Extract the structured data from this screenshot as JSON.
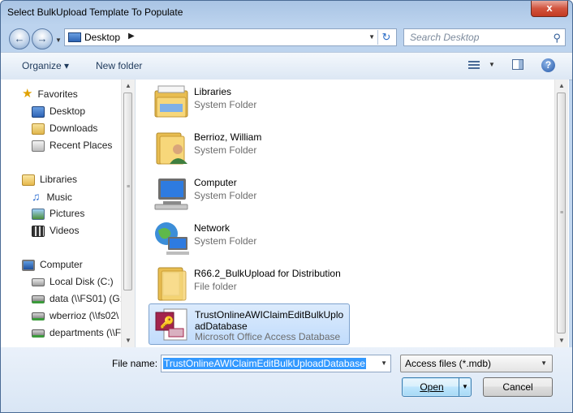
{
  "window": {
    "title": "Select BulkUpload Template To Populate",
    "close_glyph": "x"
  },
  "nav": {
    "back_glyph": "←",
    "forward_glyph": "→"
  },
  "address": {
    "location": "Desktop",
    "chevron": "▶",
    "refresh_glyph": "↻"
  },
  "search": {
    "placeholder": "Search Desktop"
  },
  "toolbar": {
    "organize_label": "Organize ▾",
    "new_folder_label": "New folder",
    "help_glyph": "?"
  },
  "sidebar": {
    "favorites": {
      "label": "Favorites",
      "items": [
        {
          "label": "Desktop",
          "icon": "desktop-icon"
        },
        {
          "label": "Downloads",
          "icon": "downloads-icon"
        },
        {
          "label": "Recent Places",
          "icon": "recent-places-icon"
        }
      ]
    },
    "libraries": {
      "label": "Libraries",
      "items": [
        {
          "label": "Music",
          "icon": "music-icon"
        },
        {
          "label": "Pictures",
          "icon": "pictures-icon"
        },
        {
          "label": "Videos",
          "icon": "videos-icon"
        }
      ]
    },
    "computer": {
      "label": "Computer",
      "items": [
        {
          "label": "Local Disk (C:)",
          "icon": "local-disk-icon"
        },
        {
          "label": "data (\\\\FS01) (G:)",
          "icon": "network-drive-icon"
        },
        {
          "label": "wberrioz (\\\\fs02\\",
          "icon": "network-drive-icon"
        },
        {
          "label": "departments (\\\\F",
          "icon": "network-drive-icon"
        }
      ]
    }
  },
  "files": [
    {
      "name": "Libraries",
      "type": "System Folder",
      "icon": "libraries-folder-icon",
      "selected": false
    },
    {
      "name": "Berrioz, William",
      "type": "System Folder",
      "icon": "user-folder-icon",
      "selected": false
    },
    {
      "name": "Computer",
      "type": "System Folder",
      "icon": "computer-icon",
      "selected": false
    },
    {
      "name": "Network",
      "type": "System Folder",
      "icon": "network-icon",
      "selected": false
    },
    {
      "name": "R66.2_BulkUpload for Distribution",
      "type": "File folder",
      "icon": "folder-icon",
      "selected": false
    },
    {
      "name": "TrustOnlineAWIClaimEditBulkUploadDatabase",
      "name_line1": "TrustOnlineAWIClaimEditBulkUplo",
      "name_line2": "adDatabase",
      "type": "Microsoft Office Access Database",
      "icon": "access-database-icon",
      "selected": true
    }
  ],
  "footer": {
    "file_name_label": "File name:",
    "file_name_value": "TrustOnlineAWIClaimEditBulkUploadDatabase",
    "filter_value": "Access files (*.mdb)",
    "open_label": "Open",
    "cancel_label": "Cancel"
  },
  "colors": {
    "accent": "#3399ff",
    "selection": "#c1dcfc",
    "frame": "#bcd3ee"
  }
}
